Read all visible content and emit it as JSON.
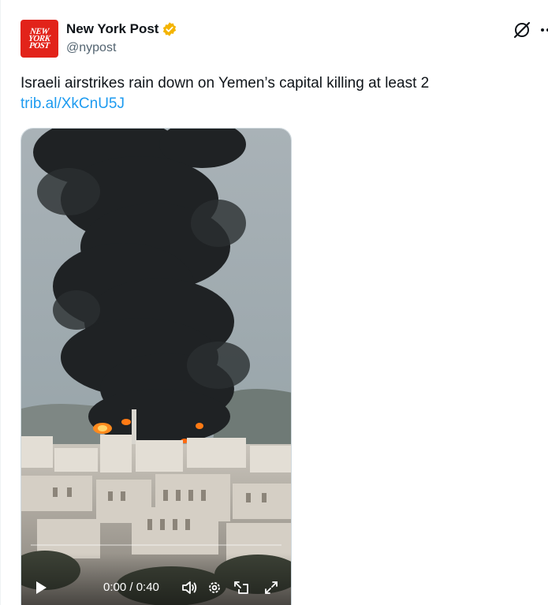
{
  "account": {
    "avatar_text": [
      "NEW",
      "YORK",
      "POST"
    ],
    "display_name": "New York Post",
    "handle": "@nypost",
    "verified_badge": "gold-check",
    "verified_color": "#f4b400"
  },
  "header_actions": {
    "grok_icon": "grok-icon",
    "more_icon": "more-icon"
  },
  "tweet": {
    "text": "Israeli airstrikes rain down on Yemen’s capital killing at least 2",
    "link": "trib.al/XkCnU5J",
    "link_color": "#1d9bf0"
  },
  "video": {
    "time": "0:00 / 0:40",
    "progress": 0,
    "controls": [
      "play-icon",
      "volume-icon",
      "settings-icon",
      "picture-in-picture-icon",
      "fullscreen-icon"
    ]
  },
  "colors": {
    "brand_red": "#e2231a",
    "text": "#0f1419",
    "muted": "#536471"
  }
}
